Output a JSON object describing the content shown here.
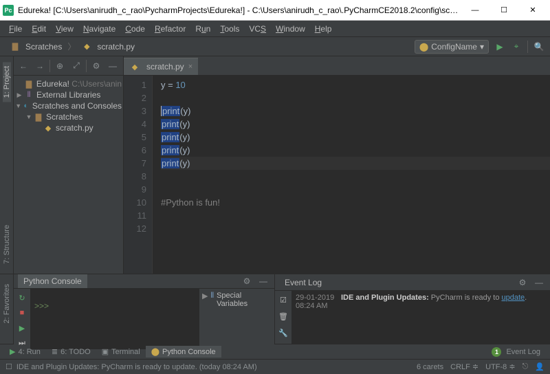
{
  "window": {
    "title": "Edureka! [C:\\Users\\anirudh_c_rao\\PycharmProjects\\Edureka!] - C:\\Users\\anirudh_c_rao\\.PyCharmCE2018.2\\config\\scratches\\s...",
    "icon_label": "Pc"
  },
  "menu": [
    "File",
    "Edit",
    "View",
    "Navigate",
    "Code",
    "Refactor",
    "Run",
    "Tools",
    "VCS",
    "Window",
    "Help"
  ],
  "breadcrumb": {
    "scratches": "Scratches",
    "file": "scratch.py"
  },
  "toolbar": {
    "config": "ConfigName",
    "run_icon": "run",
    "debug_icon": "debug",
    "search_icon": "search"
  },
  "vgutter": {
    "project": "1: Project",
    "structure": "7: Structure",
    "favorites": "2: Favorites"
  },
  "tree": {
    "root": "Edureka!",
    "root_path": "C:\\Users\\anin",
    "external": "External Libraries",
    "scratches_consoles": "Scratches and Consoles",
    "scratches": "Scratches",
    "scratch_file": "scratch.py"
  },
  "editor": {
    "tab": "scratch.py",
    "lines": [
      "1",
      "2",
      "3",
      "4",
      "5",
      "6",
      "7",
      "8",
      "9",
      "10",
      "11",
      "12"
    ],
    "code": {
      "l1_var": "y",
      "l1_op": " = ",
      "l1_val": "10",
      "print_kw": "print",
      "print_arg": "(y)",
      "comment": "#Python is fun!"
    }
  },
  "console": {
    "title": "Python Console",
    "prompt": ">>>",
    "special_vars": "Special Variables"
  },
  "eventlog": {
    "title": "Event Log",
    "date": "29-01-2019",
    "time": "08:24 AM",
    "msg_bold": "IDE and Plugin Updates:",
    "msg_rest": " PyCharm is ready to ",
    "link": "update",
    "period": "."
  },
  "bottom_tabs": {
    "run": "4: Run",
    "todo": "6: TODO",
    "terminal": "Terminal",
    "python_console": "Python Console",
    "event_log": "Event Log"
  },
  "status": {
    "msg": "IDE and Plugin Updates: PyCharm is ready to update. (today 08:24 AM)",
    "carets": "6 carets",
    "sep": "CRLF",
    "enc": "UTF-8"
  }
}
